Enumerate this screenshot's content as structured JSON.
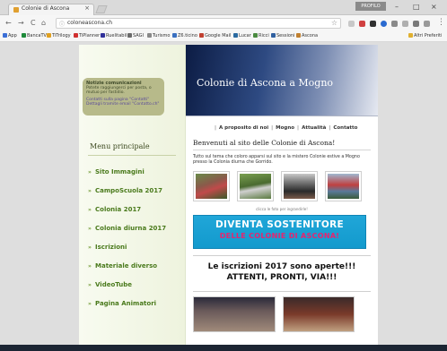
{
  "browser": {
    "tab_title": "Colonie di Ascona",
    "tab_close": "×",
    "url": "coloneascona.ch",
    "profile": "PROFILO",
    "controls": {
      "minimize": "–",
      "maximize": "□",
      "close": "×"
    },
    "nav": {
      "back": "←",
      "forward": "→",
      "reload": "C",
      "home": "⌂"
    },
    "bookmarks": [
      {
        "label": "App",
        "color": "#3b6fd6"
      },
      {
        "label": "BancaTV",
        "color": "#1e8a3a"
      },
      {
        "label": "TiTrilogy",
        "color": "#e0a020"
      },
      {
        "label": "TiPlanner",
        "color": "#d03030"
      },
      {
        "label": "Ruelitabil",
        "color": "#30309a"
      },
      {
        "label": "SAGI",
        "color": "#6a6a6a"
      },
      {
        "label": "Turismo",
        "color": "#888888"
      },
      {
        "label": "Z6.ticino",
        "color": "#3a70c0"
      },
      {
        "label": "Google Mail",
        "color": "#c04030"
      },
      {
        "label": "Lucar",
        "color": "#2a6aa0"
      },
      {
        "label": "Ricci",
        "color": "#4a8a40"
      },
      {
        "label": "Sessioni",
        "color": "#3060a0"
      },
      {
        "label": "Ascona",
        "color": "#c08030"
      },
      {
        "label": "Altri Preferiti",
        "color": "#e0b030"
      }
    ]
  },
  "sidebar": {
    "notice_title": "Notizie comunicazioni",
    "notice_lines": [
      "Potete raggiungerci per posta, o",
      "mutuo per fastidio."
    ],
    "notice_links": [
      "Contatti sulla pagina \"Contatti\"",
      "Dettagli tramite email \"Contatto.ch\""
    ],
    "menu_title": "Menu principale",
    "menu_items": [
      "Sito Immagini",
      "CampoScuola 2017",
      "Colonia 2017",
      "Colonia diurna 2017",
      "Iscrizioni",
      "Materiale diverso",
      "VideoTube",
      "Pagina Animatori"
    ]
  },
  "header": {
    "title": "Colonie di Ascona a Mogno"
  },
  "topnav": [
    "A proposito di noi",
    "Mogno",
    "Attualità",
    "Contatto"
  ],
  "main": {
    "welcome": "Benvenuti al sito delle Colonie di Ascona!",
    "intro": "Tutto sul tema che coloro apparsi sul sito e la mistero Colonie estive a Mogno presso la Colonia diurna che Gorrido.",
    "caption": "clicca le foto per ingrandirle!",
    "sostenitore_1": "DIVENTA SOSTENITORE",
    "sostenitore_2": "DELLE COLONIE DI ASCONA!",
    "iscrizioni_1": "Le iscrizioni 2017 sono aperte!!!",
    "iscrizioni_2": "ATTENTI, PRONTI, VIA!!!"
  }
}
